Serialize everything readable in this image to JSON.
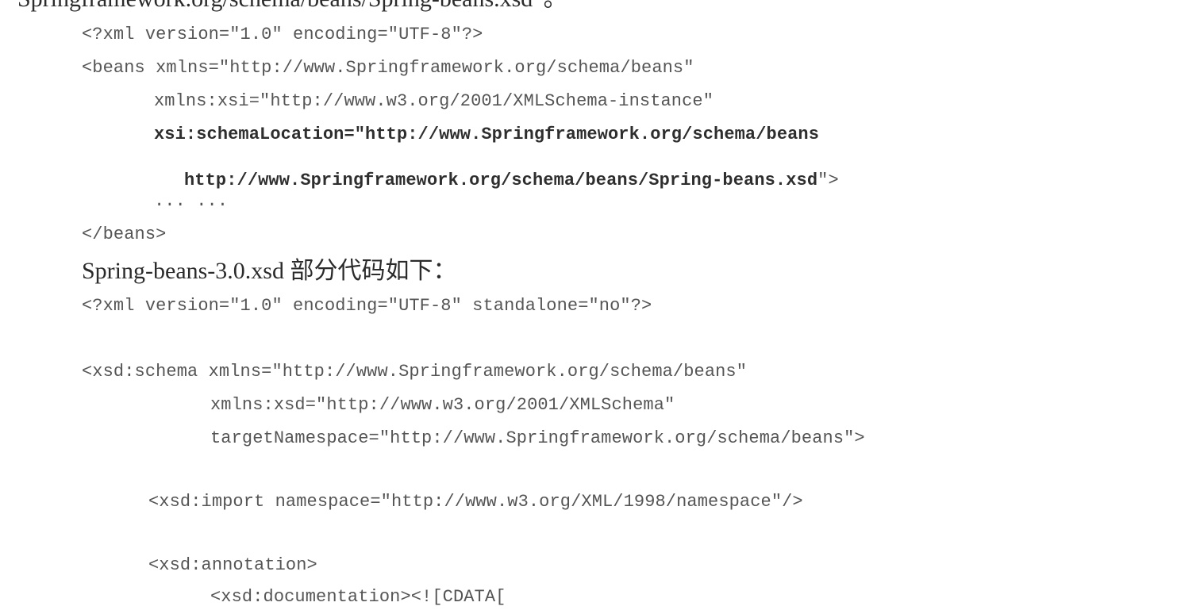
{
  "top_partial_text": "Springframework.org/schema/beans/Spring-beans.xsd”。",
  "block1": {
    "lines": [
      "<?xml version=\"1.0\" encoding=\"UTF-8\"?>",
      "<beans xmlns=\"http://www.Springframework.org/schema/beans\"",
      "xmlns:xsi=\"http://www.w3.org/2001/XMLSchema-instance\"",
      "xsi:schemaLocation=\"http://www.Springframework.org/schema/beans",
      "http://www.Springframework.org/schema/beans/Spring-beans.xsd",
      "\">",
      "... ...",
      "</beans>"
    ]
  },
  "heading": "Spring-beans-3.0.xsd 部分代码如下：",
  "block2": {
    "lines": [
      "<?xml version=\"1.0\" encoding=\"UTF-8\" standalone=\"no\"?>",
      "<xsd:schema xmlns=\"http://www.Springframework.org/schema/beans\"",
      "xmlns:xsd=\"http://www.w3.org/2001/XMLSchema\"",
      "targetNamespace=\"http://www.Springframework.org/schema/beans\">",
      "<xsd:import namespace=\"http://www.w3.org/XML/1998/namespace\"/>",
      "<xsd:annotation>",
      "<xsd:documentation><![CDATA["
    ]
  }
}
